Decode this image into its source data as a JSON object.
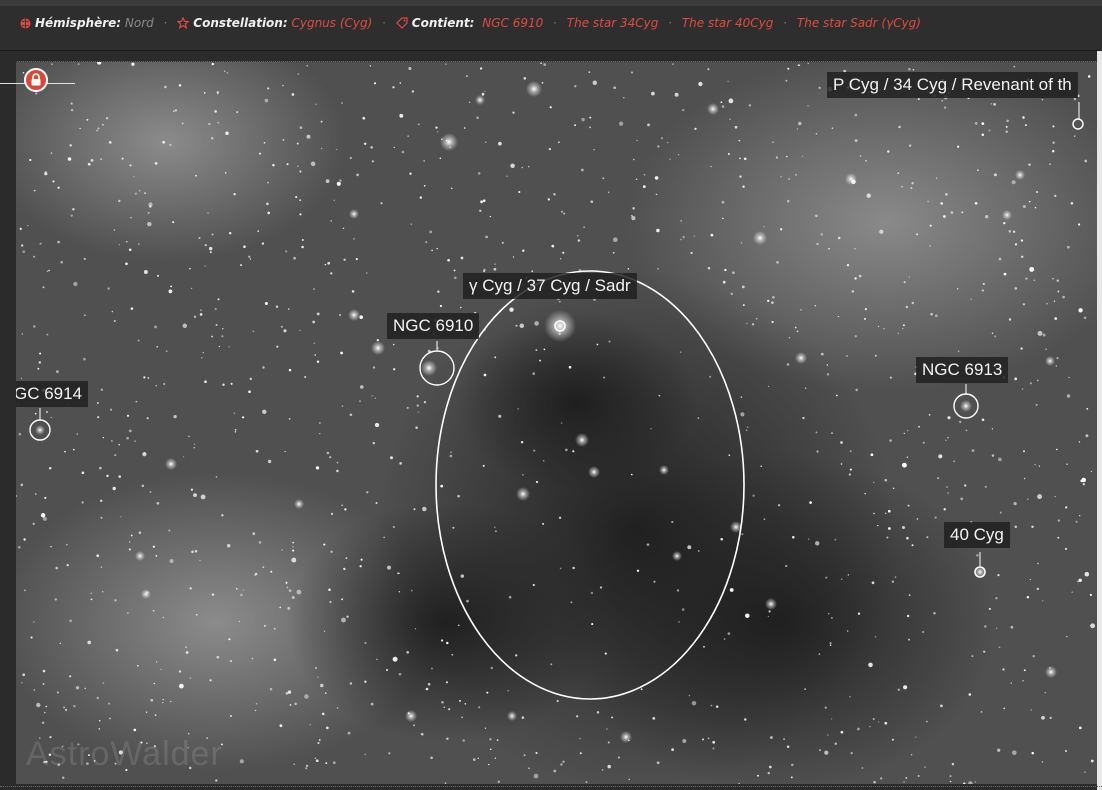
{
  "meta": {
    "hemisphere_label": "Hémisphère:",
    "hemisphere_value": "Nord",
    "constellation_label": "Constellation:",
    "constellation_value": "Cygnus (Cyg)",
    "contains_label": "Contient:",
    "contains_items": [
      "NGC 6910",
      "The star 34Cyg",
      "The star 40Cyg",
      "The star Sadr (γCyg)"
    ]
  },
  "icons": {
    "hemisphere": "globe-icon",
    "constellation": "star-icon",
    "contains": "tag-icon",
    "lock": "lock-icon"
  },
  "colors": {
    "accent": "#e04a40",
    "lock": "#d64a3a",
    "label_bg": "#1e1e1e",
    "overlay": "#ffffff"
  },
  "annotations": {
    "p_cyg": "P Cyg / 34 Cyg / Revenant of th",
    "sadr": "γ Cyg / 37 Cyg / Sadr",
    "ngc6910": "NGC 6910",
    "ngc6914": "GC 6914",
    "ngc6913": "NGC 6913",
    "cyg40": "40 Cyg"
  },
  "watermark": "AstroWalder"
}
